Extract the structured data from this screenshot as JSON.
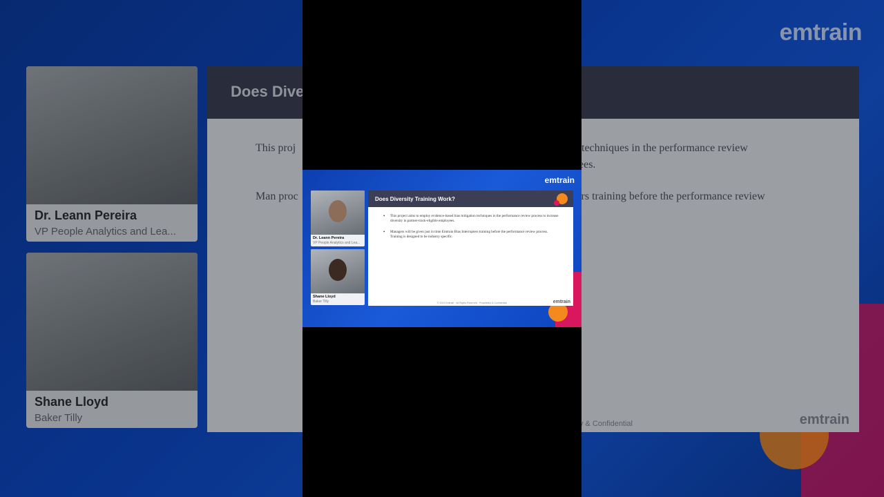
{
  "background": {
    "logo": "emtrain",
    "slide_title": "Does Dive",
    "bullet_1": "This proj",
    "bullet_1_right": "n techniques in the performance review",
    "bullet_1_right_2": "yees.",
    "bullet_2": "Man proc",
    "bullet_2_right": "ters training before the performance review",
    "conf": "etary & Confidential",
    "footer_logo": "emtrain"
  },
  "participants": [
    {
      "name": "Dr. Leann Pereira",
      "role": "VP People Analytics and Lea..."
    },
    {
      "name": "Shane Lloyd",
      "role": "Baker Tilly"
    }
  ],
  "video": {
    "logo": "emtrain",
    "slide": {
      "title": "Does Diversity Training Work?",
      "bullets": [
        "This project aims to employ evidence-based bias mitigation techniques in the performance review process to increase diversity in partner-track-eligible employees.",
        "Managers will be given just in time Emtrain Bias Interrupters training before the performance review process. Training is designed to be industry specific."
      ],
      "copyright": "© 2021 Emtrain · All Rights Reserved · Proprietary & Confidential",
      "logo": "emtrain"
    }
  },
  "colors": {
    "brand_blue": "#1456d6",
    "slide_band": "#3b3e55",
    "accent_orange": "#f48a1e",
    "accent_pink": "#d8175f"
  }
}
